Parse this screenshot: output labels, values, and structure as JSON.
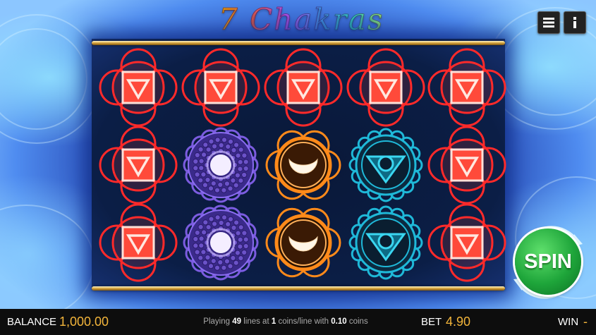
{
  "game": {
    "title": "7 Chakras"
  },
  "top_buttons": {
    "menu_icon": "hamburger-menu-icon",
    "info_icon": "info-icon"
  },
  "symbols": {
    "root": {
      "name": "root-chakra",
      "color": "#ff2a2a"
    },
    "crown": {
      "name": "crown-chakra",
      "color": "#8a5cff"
    },
    "sacral": {
      "name": "sacral-chakra",
      "color": "#ff8a1a"
    },
    "throat": {
      "name": "throat-chakra",
      "color": "#1fb8d8"
    }
  },
  "reels": [
    [
      "root",
      "root",
      "root"
    ],
    [
      "root",
      "crown",
      "crown"
    ],
    [
      "root",
      "sacral",
      "sacral"
    ],
    [
      "root",
      "throat",
      "throat"
    ],
    [
      "root",
      "root",
      "root"
    ]
  ],
  "spin": {
    "label": "SPIN",
    "color": "#1ea53a"
  },
  "bottom_bar": {
    "balance_label": "BALANCE",
    "balance_value": "1,000.00",
    "playing_prefix": "Playing",
    "lines": "49",
    "lines_text": "lines at",
    "coins_per_line": "1",
    "coins_text": "coins/line with",
    "coin_value": "0.10",
    "coins_suffix": "coins",
    "bet_label": "BET",
    "bet_value": "4.90",
    "win_label": "WIN",
    "win_value": "-"
  },
  "colors": {
    "accent": "#f3b53b",
    "bar_background": "#0d0d0d"
  }
}
